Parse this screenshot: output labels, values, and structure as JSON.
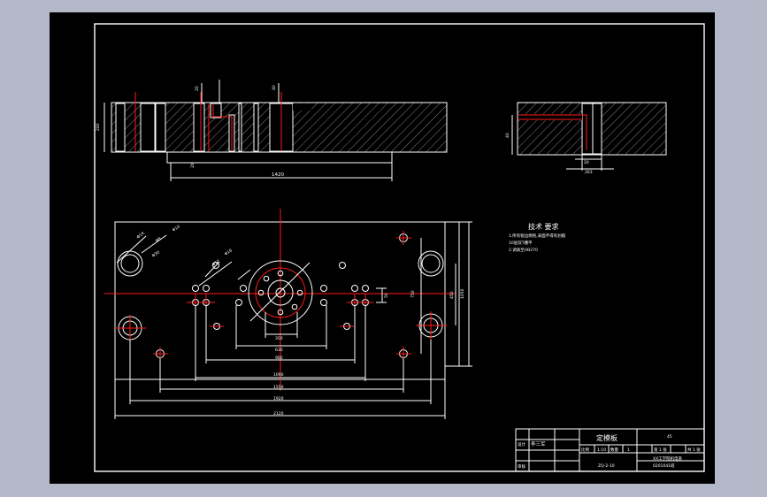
{
  "colors": {
    "window_bg": "#b4b9c9",
    "canvas_bg": "#000000",
    "line": "#ffffff",
    "highlight": "#ff1a1a"
  },
  "dimensions": {
    "top_length": "1420",
    "top_height": "240",
    "top_hole_depth_left": "20",
    "top_hole_depth_right": "40",
    "top_base": "20",
    "right_width_a": "20",
    "right_width_b": "263",
    "right_height": "40",
    "d_350": "350",
    "d_630": "630",
    "d_960": "960",
    "d_1090": "1090",
    "d_1550": "1550",
    "d_1920": "1920",
    "d_2120": "2120",
    "v_750": "750",
    "v_450": "450",
    "v_50": "50",
    "v_1050": "1050",
    "phi_hole_a": "Φ14",
    "phi_hole_b": "Φ8",
    "phi_hole_c": "Φ10",
    "phi_hole_d": "Φ30",
    "phi_center": "Φ12",
    "phi_big": "Φ16"
  },
  "tech_req": {
    "title": "技术 要求",
    "line1": "1.所有锐边倒钝,表面不得有划痕",
    "line2": "10层双T槽平",
    "line3": "2.调质至HB270"
  },
  "title_block": {
    "part_name": "定模板",
    "material": "45",
    "scale_label": "比例",
    "scale_value": "1:10",
    "qty_label": "数量",
    "qty_value": "1",
    "sheet_label": "第 1 张",
    "sheets_label": "共 1 张",
    "designer_label": "设计",
    "designer_name": "李三军",
    "check_label": "审核",
    "drawing_no": "ZQ-2-10",
    "school": "XX工学院机电系",
    "class": "0201041班"
  }
}
